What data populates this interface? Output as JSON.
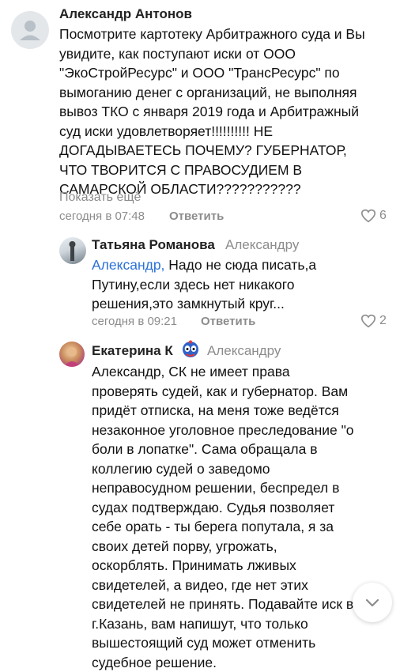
{
  "comments": [
    {
      "author": "Александр Антонов",
      "text": "Посмотрите картотеку Арбитражного суда и Вы увидите, как поступают иски от ООО \"ЭкоСтройРесурс\" и ООО \"ТрансРесурс\" по вымоганию денег с организаций, не выполняя вывоз ТКО с января 2019 года и Арбитражный суд иски удовлетворяет!!!!!!!!!! НЕ ДОГАДЫВАЕТЕСЬ ПОЧЕМУ? ГУБЕРНАТОР, ЧТО ТВОРИТСЯ С ПРАВОСУДИЕМ В САМАРСКОЙ ОБЛАСТИ???????????",
      "show_more": "Показать ещё",
      "time": "сегодня в 07:48",
      "reply_label": "Ответить",
      "likes": "6",
      "avatar_icon": "default-user-avatar-icon"
    },
    {
      "author": "Татьяна Романова",
      "reply_to": "Александру",
      "mention": "Александр,",
      "text": " Надо не сюда писать,а Путину,если здесь нет никакого решения,это замкнутый круг...",
      "time": "сегодня в 09:21",
      "reply_label": "Ответить",
      "likes": "2",
      "avatar_icon": "user-photo-avatar"
    },
    {
      "author": "Екатерина К",
      "author_badge_icon": "mask-emoji-icon",
      "reply_to": "Александру",
      "text": "Александр, СК не имеет права проверять судей, как и губернатор. Вам придёт отписка, на меня тоже ведётся незаконное уголовное преследование \"о боли в лопатке\". Сама обращала в коллегию судей о заведомо неправосудном решении, беспредел в судах подтверждаю. Судья позволяет себе орать - ты берега попутала, я за своих детей порву, угрожать, оскорблять. Принимать лживых свидетелей, а видео, где нет этих свидетелей не принять. Подавайте иск в г.Казань, вам напишут, что только вышестоящий суд может отменить судебное решение.",
      "avatar_icon": "user-photo-avatar"
    }
  ],
  "scroll_button_icon": "chevron-down-icon",
  "colors": {
    "link": "#2b71d6",
    "secondary": "#8c8c8c"
  }
}
